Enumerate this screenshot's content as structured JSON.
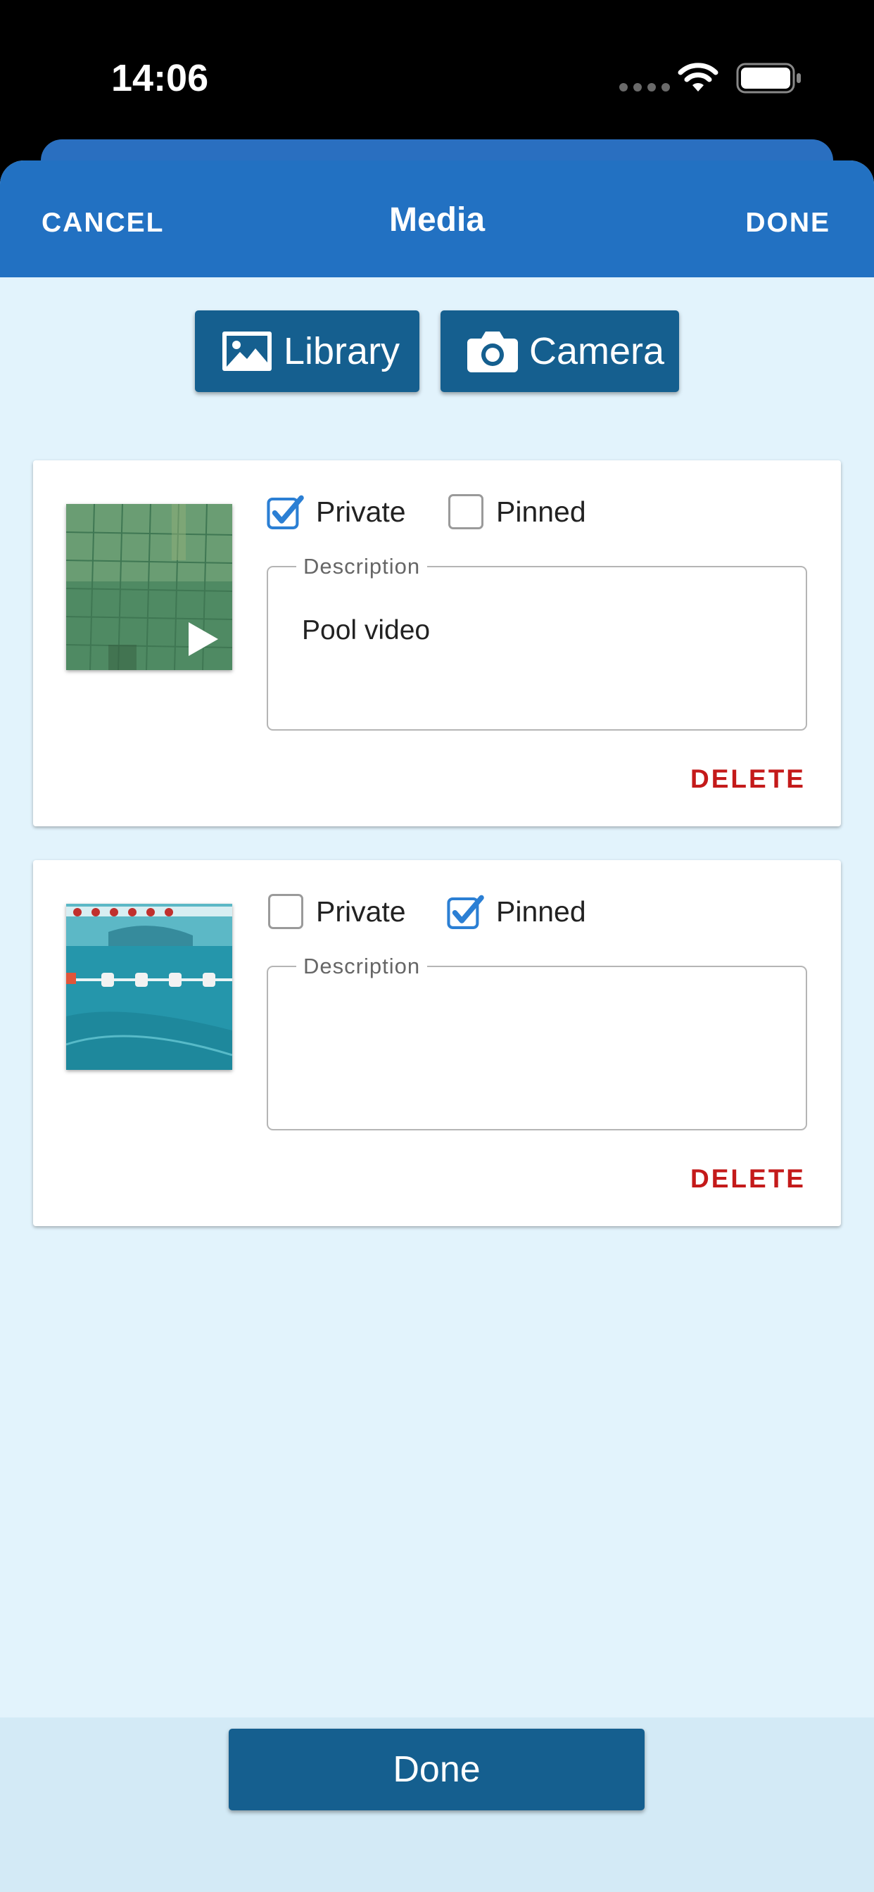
{
  "status_bar": {
    "time": "14:06"
  },
  "header": {
    "title": "Media",
    "cancel_label": "CANCEL",
    "done_label": "DONE"
  },
  "source_buttons": {
    "library": {
      "label": "Library",
      "icon": "photo-library-icon"
    },
    "camera": {
      "label": "Camera",
      "icon": "camera-icon"
    }
  },
  "media_items": [
    {
      "thumbnail_icon": "video-thumbnail",
      "is_video": true,
      "private": {
        "label": "Private",
        "checked": true
      },
      "pinned": {
        "label": "Pinned",
        "checked": false
      },
      "description_label": "Description",
      "description_value": "Pool video",
      "delete_label": "DELETE"
    },
    {
      "thumbnail_icon": "photo-thumbnail",
      "is_video": false,
      "private": {
        "label": "Private",
        "checked": false
      },
      "pinned": {
        "label": "Pinned",
        "checked": true
      },
      "description_label": "Description",
      "description_value": "",
      "delete_label": "DELETE"
    }
  ],
  "footer": {
    "done_label": "Done"
  },
  "colors": {
    "header": "#2271c2",
    "button": "#155f8f",
    "background": "#e2f3fc",
    "checkbox_checked": "#2b7fd4",
    "delete": "#c41a1a"
  }
}
